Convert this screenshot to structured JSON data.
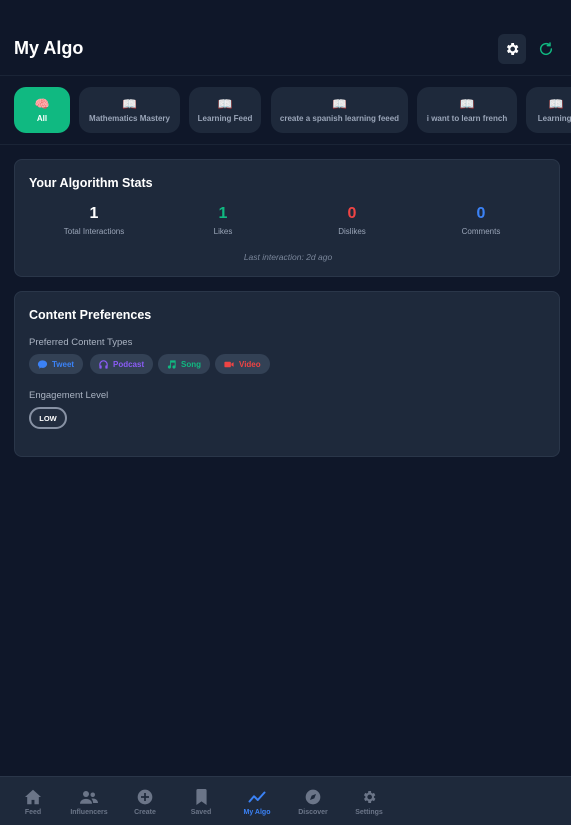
{
  "header": {
    "title": "My Algo"
  },
  "chips": [
    {
      "label": "All",
      "icon": "brain-icon",
      "active": true
    },
    {
      "label": "Mathematics Mastery",
      "icon": "book-icon"
    },
    {
      "label": "Learning Feed",
      "icon": "book-icon"
    },
    {
      "label": "create a spanish learning feeed",
      "icon": "book-icon"
    },
    {
      "label": "i want to learn french",
      "icon": "book-icon"
    },
    {
      "label": "Learning:",
      "icon": "book-icon"
    }
  ],
  "stats": {
    "title": "Your Algorithm Stats",
    "items": [
      {
        "value": "1",
        "label": "Total Interactions",
        "color": "#ffffff"
      },
      {
        "value": "1",
        "label": "Likes",
        "color": "#10b981"
      },
      {
        "value": "0",
        "label": "Dislikes",
        "color": "#ef4444"
      },
      {
        "value": "0",
        "label": "Comments",
        "color": "#3b82f6"
      }
    ],
    "last_interaction": "Last interaction: 2d ago"
  },
  "preferences": {
    "title": "Content Preferences",
    "types_label": "Preferred Content Types",
    "types": [
      {
        "label": "Tweet",
        "icon": "chat-bubble-icon",
        "color": "#3b82f6"
      },
      {
        "label": "Podcast",
        "icon": "headphones-icon",
        "color": "#8b5cf6"
      },
      {
        "label": "Song",
        "icon": "music-note-icon",
        "color": "#10b981"
      },
      {
        "label": "Video",
        "icon": "video-camera-icon",
        "color": "#ef4444"
      }
    ],
    "engagement_label": "Engagement Level",
    "engagement_value": "LOW"
  },
  "nav": [
    {
      "label": "Feed",
      "icon": "home-icon"
    },
    {
      "label": "Influencers",
      "icon": "users-icon"
    },
    {
      "label": "Create",
      "icon": "plus-circle-icon"
    },
    {
      "label": "Saved",
      "icon": "bookmark-icon"
    },
    {
      "label": "My Algo",
      "icon": "trend-icon",
      "active": true
    },
    {
      "label": "Discover",
      "icon": "compass-icon"
    },
    {
      "label": "Settings",
      "icon": "gear-icon"
    }
  ],
  "colors": {
    "background": "#0f1729",
    "card": "#1e293b",
    "accent_green": "#10b981",
    "accent_blue": "#3b82f6"
  }
}
